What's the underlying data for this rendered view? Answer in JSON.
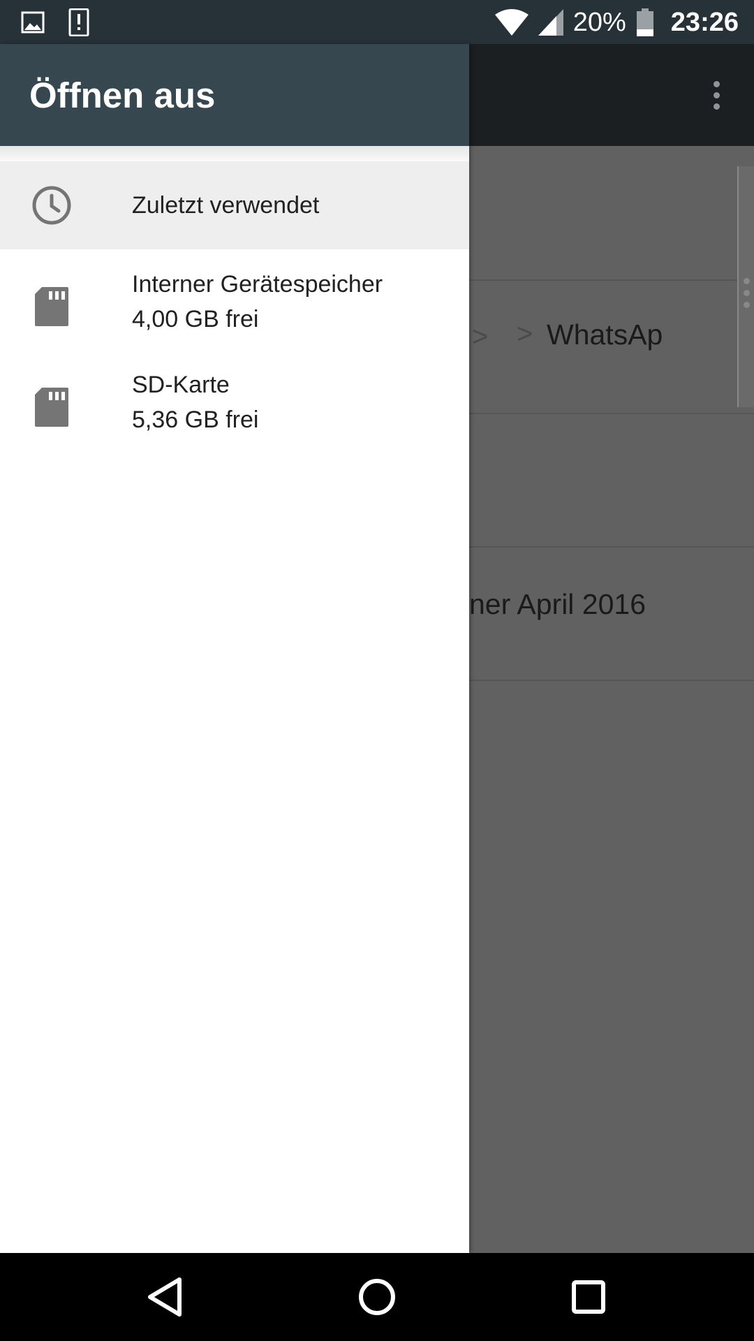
{
  "status_bar": {
    "battery_percent": "20%",
    "time": "23:26",
    "icons": [
      "image-notification-icon",
      "alert-notification-icon",
      "wifi-icon",
      "cell-signal-icon",
      "battery-icon"
    ]
  },
  "background_app": {
    "breadcrumb_item": "WhatsAp",
    "list_item_text": "ner April 2016"
  },
  "drawer": {
    "title": "Öffnen aus",
    "items": [
      {
        "icon": "clock-icon",
        "label": "Zuletzt verwendet",
        "selected": true
      },
      {
        "icon": "sd-card-icon",
        "label": "Interner Gerätespeicher",
        "sub": "4,00 GB frei",
        "selected": false
      },
      {
        "icon": "sd-card-icon",
        "label": "SD-Karte",
        "sub": "5,36 GB frei",
        "selected": false
      }
    ]
  },
  "navigation_bar": {
    "buttons": [
      "back-icon",
      "home-icon",
      "recents-icon"
    ]
  },
  "colors": {
    "status_bar": "#263238",
    "drawer_header": "#37474f",
    "selected_item": "#eeeeee",
    "scrim": "#616161"
  }
}
